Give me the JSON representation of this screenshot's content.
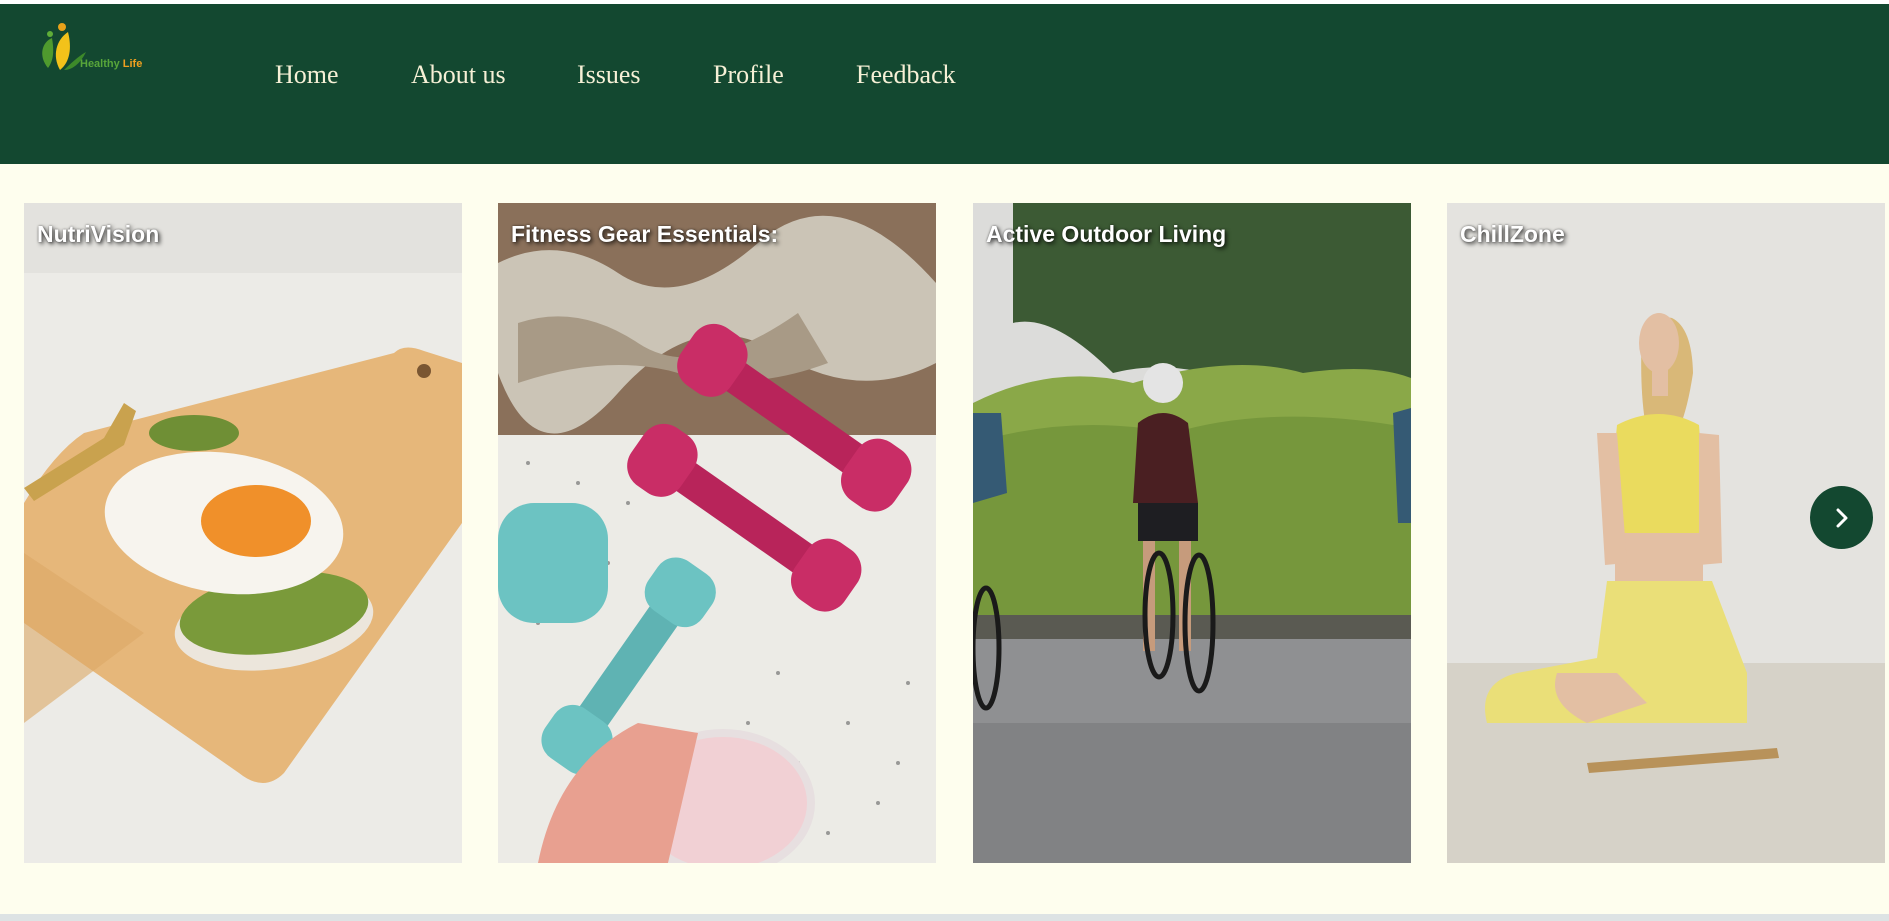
{
  "brand": {
    "logo_word1": "Healthy",
    "logo_word2": "Life"
  },
  "nav": {
    "items": [
      {
        "label": "Home"
      },
      {
        "label": "About us"
      },
      {
        "label": "Issues"
      },
      {
        "label": "Profile"
      },
      {
        "label": "Feedback"
      }
    ]
  },
  "carousel": {
    "cards": [
      {
        "title": "NutriVision"
      },
      {
        "title": "Fitness Gear Essentials:"
      },
      {
        "title": "Active Outdoor Living"
      },
      {
        "title": "ChillZone"
      }
    ],
    "next_icon": "chevron-right-icon"
  },
  "colors": {
    "header_bg": "#134830",
    "page_bg": "#fefeee",
    "nav_text": "#f6f0d6",
    "logo_green": "#58a63a",
    "logo_orange": "#f0a020"
  }
}
